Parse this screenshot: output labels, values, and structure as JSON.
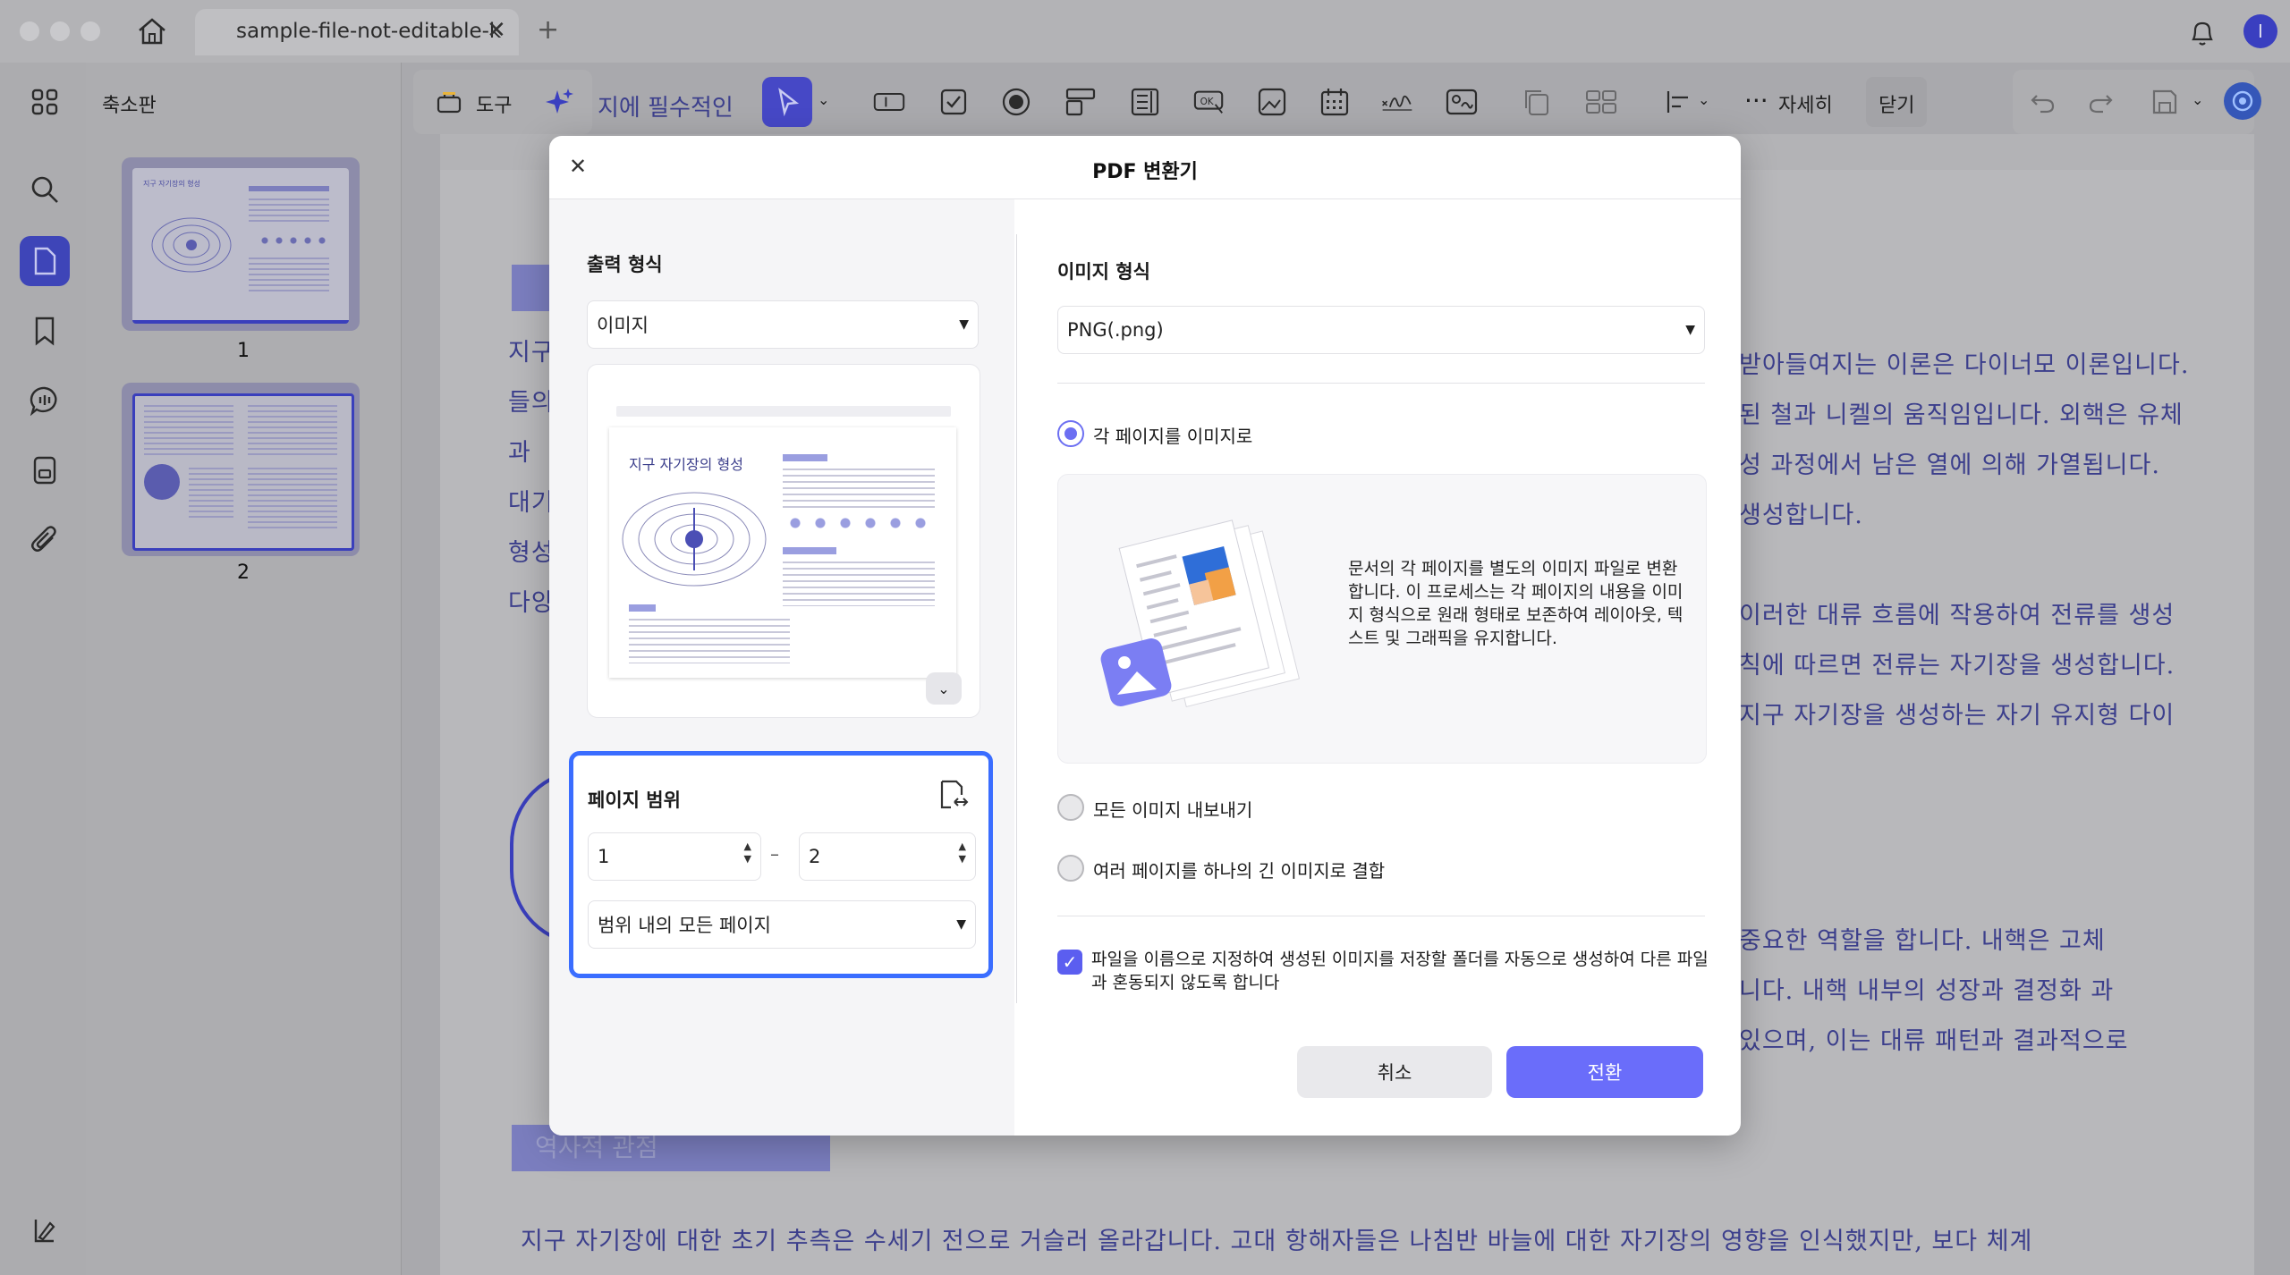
{
  "titlebar": {
    "tab_title": "sample-file-not-editable-k",
    "tab_close": "✕",
    "new_tab": "+",
    "avatar_initial": "I"
  },
  "sidebar": {
    "panel_title": "축소판",
    "thumbnails": [
      {
        "label": "1",
        "page_title": "지구 자기장의 형성"
      },
      {
        "label": "2"
      }
    ]
  },
  "toolbar": {
    "tools_label": "도구",
    "ai_prompt": "지에 필수적인",
    "more_label": "자세히",
    "close_label": "닫기"
  },
  "document": {
    "heading_bottom": "역사적 관점",
    "left_fragments": [
      "지구",
      "들의",
      "과",
      "대기",
      "형성",
      "다양"
    ],
    "right_lines": [
      "받아들여지는 이론은 다이너모 이론입니다.",
      "된 철과 니켈의 움직임입니다. 외핵은 유체",
      "성 과정에서 남은 열에 의해 가열됩니다.",
      "생성합니다.",
      "이러한 대류 흐름에 작용하여 전류를 생성",
      "칙에 따르면 전류는 자기장을 생성합니다.",
      "지구 자기장을 생성하는 자기 유지형 다이",
      "중요한 역할을 합니다. 내핵은 고체",
      "니다. 내핵 내부의 성장과 결정화 과",
      "있으며, 이는 대류 패턴과 결과적으로"
    ],
    "bottom_line": "지구 자기장에 대한 초기 추측은 수세기 전으로 거슬러 올라갑니다. 고대 항해자들은 나침반 바늘에 대한 자기장의 영향을 인식했지만, 보다 체계"
  },
  "dialog": {
    "title": "PDF 변환기",
    "close": "✕",
    "output_format_label": "출력 형식",
    "output_format_value": "이미지",
    "preview_page_title": "지구 자기장의 형성",
    "page_range": {
      "label": "페이지 범위",
      "from": "1",
      "dash": "–",
      "to": "2",
      "subset_value": "범위 내의 모든 페이지"
    },
    "image_format_label": "이미지 형식",
    "image_format_value": "PNG(.png)",
    "options": [
      {
        "label": "각 페이지를 이미지로",
        "selected": true
      },
      {
        "label": "모든 이미지 내보내기",
        "selected": false
      },
      {
        "label": "여러 페이지를 하나의 긴 이미지로 결합",
        "selected": false
      }
    ],
    "description": "문서의 각 페이지를 별도의 이미지 파일로 변환합니다. 이 프로세스는 각 페이지의 내용을 이미지 형식으로 원래 형태로 보존하여 레이아웃, 텍스트 및 그래픽을 유지합니다.",
    "checkbox_label": "파일을 이름으로 지정하여 생성된 이미지를 저장할 폴더를 자동으로 생성하여 다른 파일과 혼동되지 않도록 합니다",
    "checkbox_checked": true,
    "cancel": "취소",
    "convert": "전환"
  },
  "colors": {
    "accent": "#6a6dfa",
    "focus_border": "#3a6dff",
    "doc_text": "#3c3f8c"
  }
}
